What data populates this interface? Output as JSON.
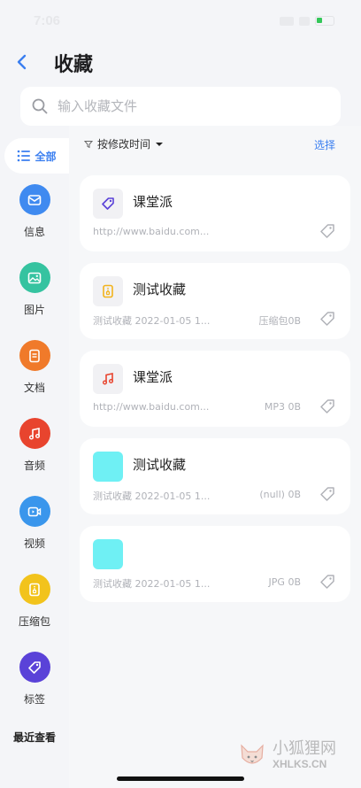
{
  "status_bar": {
    "time": "7:06"
  },
  "header": {
    "title": "收藏",
    "back_icon": "chevron-left-icon"
  },
  "search": {
    "placeholder": "输入收藏文件",
    "value": ""
  },
  "sidebar": {
    "all_label": "全部",
    "items": [
      {
        "label": "信息",
        "icon": "mail-icon",
        "color": "#3f8af0"
      },
      {
        "label": "图片",
        "icon": "image-icon",
        "color": "#35c3a0"
      },
      {
        "label": "文档",
        "icon": "document-icon",
        "color": "#f07a2a"
      },
      {
        "label": "音频",
        "icon": "music-icon",
        "color": "#e8442e"
      },
      {
        "label": "视频",
        "icon": "video-icon",
        "color": "#3a96ec"
      },
      {
        "label": "压缩包",
        "icon": "archive-icon",
        "color": "#f2c31c"
      },
      {
        "label": "标签",
        "icon": "tag-icon",
        "color": "#5a42d8"
      }
    ],
    "recent_label": "最近查看"
  },
  "toolbar": {
    "sort_label": "按修改时间",
    "select_label": "选择"
  },
  "items": [
    {
      "title": "课堂派",
      "subtitle": "http://www.baidu.com...",
      "type_size": "",
      "icon": "link-tag-icon",
      "icon_color": "#5a42d8"
    },
    {
      "title": "测试收藏",
      "subtitle": "测试收藏  2022-01-05 1...",
      "type_size": "压缩包0B",
      "icon": "archive-icon",
      "icon_color": "#f2b31c"
    },
    {
      "title": "课堂派",
      "subtitle": "http://www.baidu.com...",
      "type_size": "MP3 0B",
      "icon": "music-icon",
      "icon_color": "#e8442e"
    },
    {
      "title": "测试收藏",
      "subtitle": "测试收藏  2022-01-05 1...",
      "type_size": "(null) 0B",
      "icon": "image-thumbnail",
      "icon_color": "#6ff0f4"
    },
    {
      "title": "",
      "subtitle": "测试收藏  2022-01-05 1...",
      "type_size": "JPG 0B",
      "icon": "image-thumbnail",
      "icon_color": "#6ff0f4"
    }
  ],
  "watermark": {
    "text_cn": "小狐狸网",
    "text_en": "XHLKS.CN"
  }
}
